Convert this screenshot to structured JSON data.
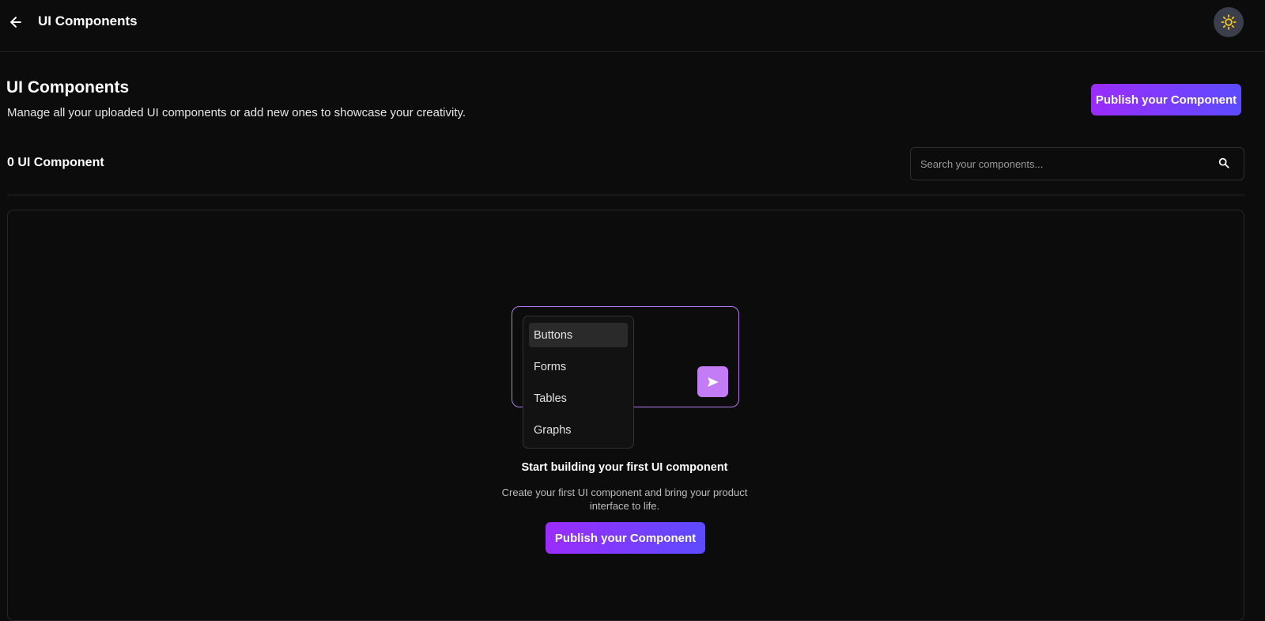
{
  "header": {
    "title": "UI Components",
    "back_icon": "arrow-left-icon",
    "theme_icon": "sun-icon",
    "theme_icon_color": "#f5c518"
  },
  "page": {
    "title": "UI Components",
    "subtitle": "Manage all your uploaded UI components or add new ones to showcase your creativity.",
    "publish_label": "Publish your Component"
  },
  "toolbar": {
    "count_label": "0 UI Component",
    "search_placeholder": "Search your components...",
    "search_icon": "search-icon"
  },
  "empty_state": {
    "menu_items": [
      "Buttons",
      "Forms",
      "Tables",
      "Graphs"
    ],
    "active_item": "Buttons",
    "send_icon": "send-icon",
    "title": "Start building your first UI component",
    "description": "Create your first UI component and bring your product interface to life.",
    "publish_label": "Publish your Component"
  },
  "colors": {
    "background": "#0c0c0c",
    "accent_gradient_start": "#9b2cfb",
    "accent_gradient_end": "#5c4bff",
    "illustration_border": "#b07bf0",
    "send_button": "#c37cf5"
  }
}
